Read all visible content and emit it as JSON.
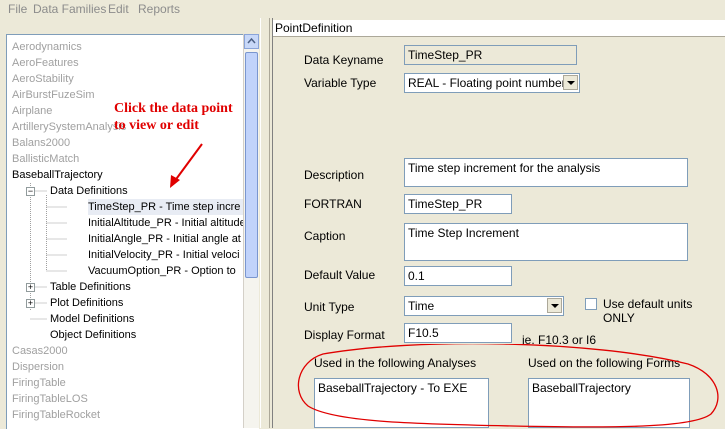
{
  "menu": [
    "File",
    "Data Families",
    "Edit",
    "Reports"
  ],
  "tree": {
    "top_items": [
      "Aerodynamics",
      "AeroFeatures",
      "AeroStability",
      "AirBurstFuzeSim",
      "Airplane",
      "ArtillerySystemAnalysis",
      "Balans2000",
      "BallisticMatch"
    ],
    "expanded_item": "BaseballTrajectory",
    "data_definitions_label": "Data Definitions",
    "data_items": [
      "TimeStep_PR  -  Time step incre",
      "InitialAltitude_PR  -  Initial altitude",
      "InitialAngle_PR  -  Initial angle at",
      "InitialVelocity_PR  -  Initial veloci",
      "VacuumOption_PR  -  Option to"
    ],
    "sub_folders": [
      "Table Definitions",
      "Plot Definitions",
      "Model Definitions",
      "Object Definitions"
    ],
    "bottom_items": [
      "Casas2000",
      "Dispersion",
      "FiringTable",
      "FiringTableLOS",
      "FiringTableRocket"
    ],
    "expander_minus": "−",
    "expander_plus": "+"
  },
  "callout": {
    "line1": "Click the data point",
    "line2": "to view or edit"
  },
  "panel": {
    "title": "PointDefinition",
    "keyname_label": "Data Keyname",
    "keyname_value": "TimeStep_PR",
    "vartype_label": "Variable Type",
    "vartype_value": "REAL - Floating point number",
    "description_label": "Description",
    "description_value": "Time step increment for the analysis",
    "fortran_label": "FORTRAN",
    "fortran_value": "TimeStep_PR",
    "caption_label": "Caption",
    "caption_value": "Time Step Increment",
    "default_label": "Default Value",
    "default_value": "0.1",
    "unittype_label": "Unit Type",
    "unittype_value": "Time",
    "default_units_label": "Use default units ONLY",
    "displayformat_label": "Display Format",
    "displayformat_value": "F10.5",
    "format_hint": "ie. F10.3 or I6",
    "analyses_label": "Used in the following Analyses",
    "analyses_items": [
      "BaseballTrajectory  -  To EXE"
    ],
    "forms_label": "Used on the following Forms",
    "forms_items": [
      "BaseballTrajectory"
    ]
  },
  "colors": {
    "annotation": "#e00000",
    "disabled_text": "#a0a0a0",
    "window_bg": "#ece9d8"
  }
}
